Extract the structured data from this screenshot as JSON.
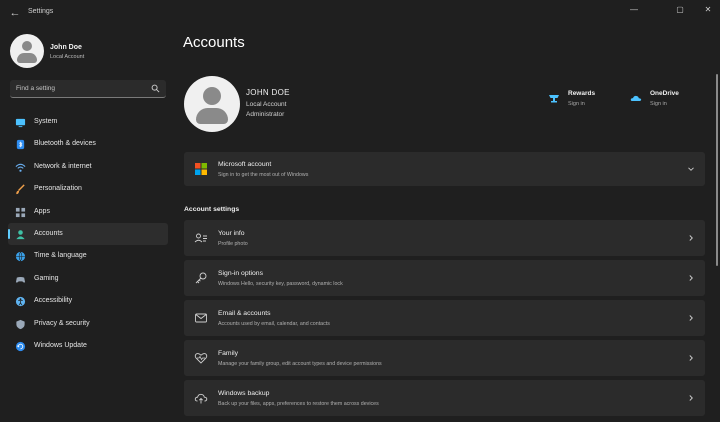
{
  "window": {
    "title": "Settings",
    "back_glyph": "←",
    "min_glyph": "—",
    "max_glyph": "▢",
    "close_glyph": "✕"
  },
  "sidebar": {
    "user": {
      "name": "John Doe",
      "account_type": "Local Account"
    },
    "search": {
      "placeholder": "Find a setting"
    },
    "items": [
      {
        "label": "System",
        "icon": "system-icon",
        "color": "#4cc2ff"
      },
      {
        "label": "Bluetooth & devices",
        "icon": "bluetooth-icon",
        "color": "#2d8cf0"
      },
      {
        "label": "Network & internet",
        "icon": "network-icon",
        "color": "#6ab0f3"
      },
      {
        "label": "Personalization",
        "icon": "brush-icon",
        "color": "#f0a04b"
      },
      {
        "label": "Apps",
        "icon": "apps-icon",
        "color": "#9aa8b8"
      },
      {
        "label": "Accounts",
        "icon": "accounts-icon",
        "color": "#3fc1a6",
        "active": true
      },
      {
        "label": "Time & language",
        "icon": "globe-icon",
        "color": "#3aa0e8"
      },
      {
        "label": "Gaming",
        "icon": "gaming-icon",
        "color": "#9aa8b8"
      },
      {
        "label": "Accessibility",
        "icon": "accessibility-icon",
        "color": "#5fb3f0"
      },
      {
        "label": "Privacy & security",
        "icon": "shield-icon",
        "color": "#9aa8b8"
      },
      {
        "label": "Windows Update",
        "icon": "update-icon",
        "color": "#2d8cf0"
      }
    ]
  },
  "main": {
    "title": "Accounts",
    "account": {
      "name": "JOHN DOE",
      "type": "Local Account",
      "role": "Administrator"
    },
    "services": [
      {
        "title": "Rewards",
        "subtitle": "Sign in",
        "icon": "rewards-icon"
      },
      {
        "title": "OneDrive",
        "subtitle": "Sign in",
        "icon": "onedrive-icon"
      }
    ],
    "microsoft_account": {
      "title": "Microsoft account",
      "subtitle": "Sign in to get the most out of Windows",
      "icon": "microsoft-logo-icon"
    },
    "section_label": "Account settings",
    "settings": [
      {
        "title": "Your info",
        "subtitle": "Profile photo",
        "icon": "your-info-icon"
      },
      {
        "title": "Sign-in options",
        "subtitle": "Windows Hello, security key, password, dynamic lock",
        "icon": "key-icon"
      },
      {
        "title": "Email & accounts",
        "subtitle": "Accounts used by email, calendar, and contacts",
        "icon": "mail-icon"
      },
      {
        "title": "Family",
        "subtitle": "Manage your family group, edit account types and device permissions",
        "icon": "family-heart-icon"
      },
      {
        "title": "Windows backup",
        "subtitle": "Back up your files, apps, preferences to restore them across devices",
        "icon": "backup-icon"
      }
    ]
  },
  "colors": {
    "accent": "#60cdff",
    "background": "#1f1f1f",
    "card": "#2b2b2b"
  }
}
